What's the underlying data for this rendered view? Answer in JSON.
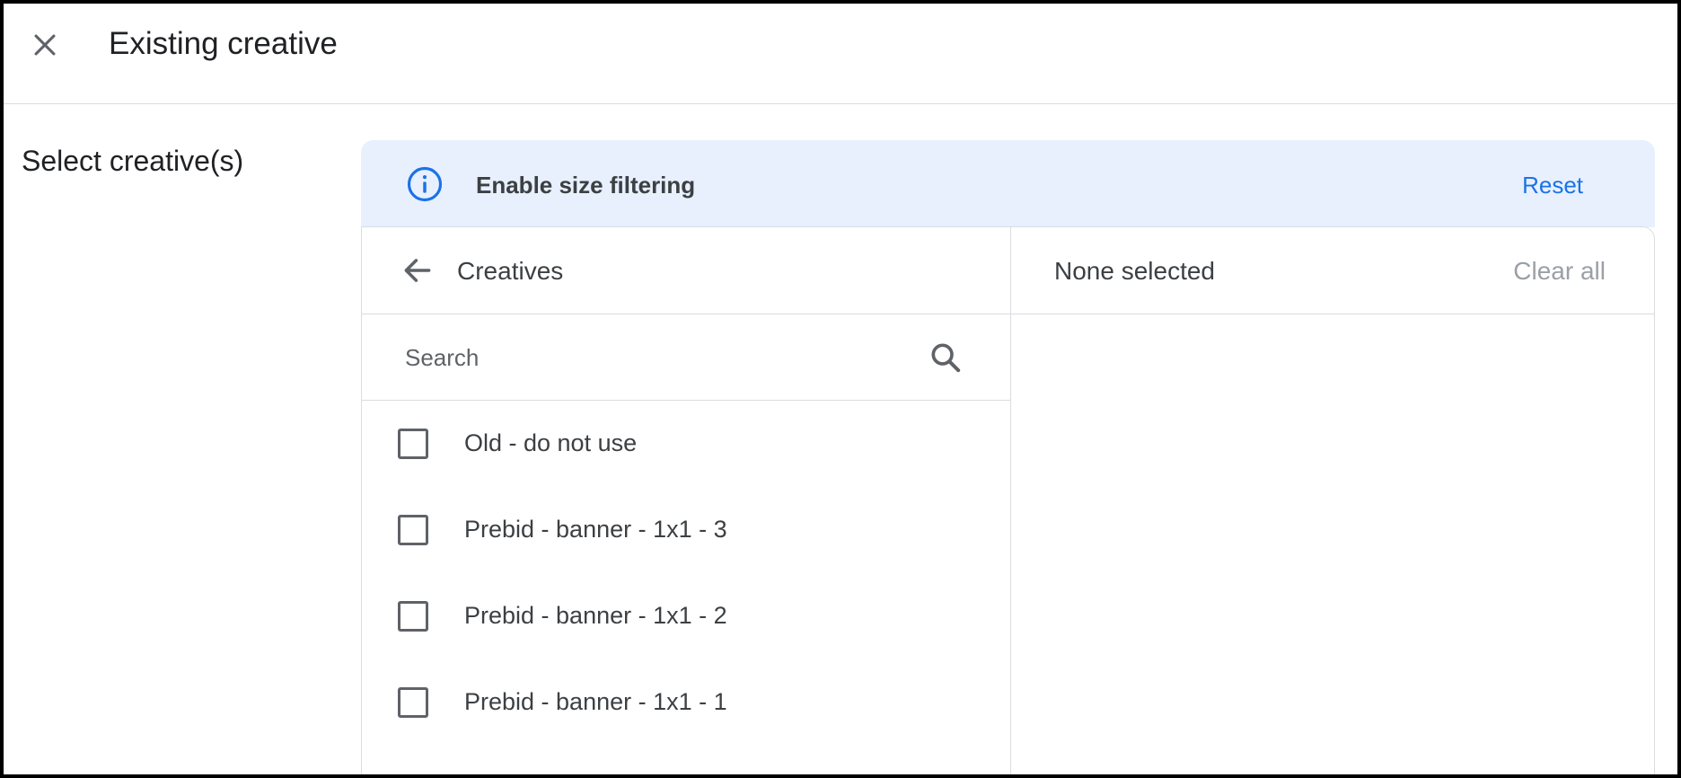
{
  "dialog": {
    "title": "Existing creative"
  },
  "section": {
    "label": "Select creative(s)"
  },
  "banner": {
    "text": "Enable size filtering",
    "reset_label": "Reset",
    "icon": "info-icon",
    "background_color": "#e8f0fe",
    "accent_color": "#1a73e8"
  },
  "picker": {
    "left": {
      "title": "Creatives",
      "search_placeholder": "Search",
      "search_value": "",
      "items": [
        {
          "label": "Old - do not use",
          "checked": false
        },
        {
          "label": "Prebid - banner - 1x1 - 3",
          "checked": false
        },
        {
          "label": "Prebid - banner - 1x1 - 2",
          "checked": false
        },
        {
          "label": "Prebid - banner - 1x1 - 1",
          "checked": false
        }
      ]
    },
    "right": {
      "title": "None selected",
      "clear_all_label": "Clear all"
    }
  }
}
